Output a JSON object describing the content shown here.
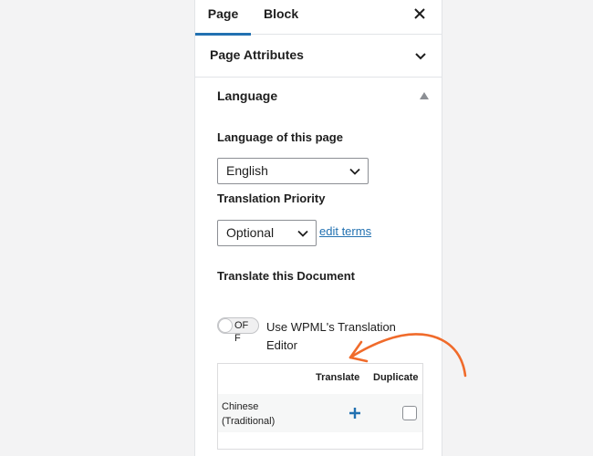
{
  "tabs": {
    "page": "Page",
    "block": "Block"
  },
  "icons": {
    "close": "close-icon",
    "chevron": "chevron-down-icon",
    "collapse": "triangle-up-icon",
    "plus": "plus-icon",
    "arrow": "annotation-arrow-icon"
  },
  "page_attributes": {
    "title": "Page Attributes"
  },
  "language": {
    "title": "Language",
    "language_label": "Language of this page",
    "language_value": "English",
    "priority_label": "Translation Priority",
    "priority_value": "Optional",
    "edit_terms": "edit terms",
    "translate_doc_label": "Translate this Document",
    "toggle_state": "OFF",
    "toggle_label": "Use WPML's Translation Editor",
    "table": {
      "headers": {
        "translate": "Translate",
        "duplicate": "Duplicate"
      },
      "rows": [
        {
          "language": "Chinese (Traditional)"
        }
      ]
    }
  },
  "colors": {
    "accent": "#2271b1",
    "annotation": "#f06b2b",
    "border": "#e2e4e7"
  }
}
